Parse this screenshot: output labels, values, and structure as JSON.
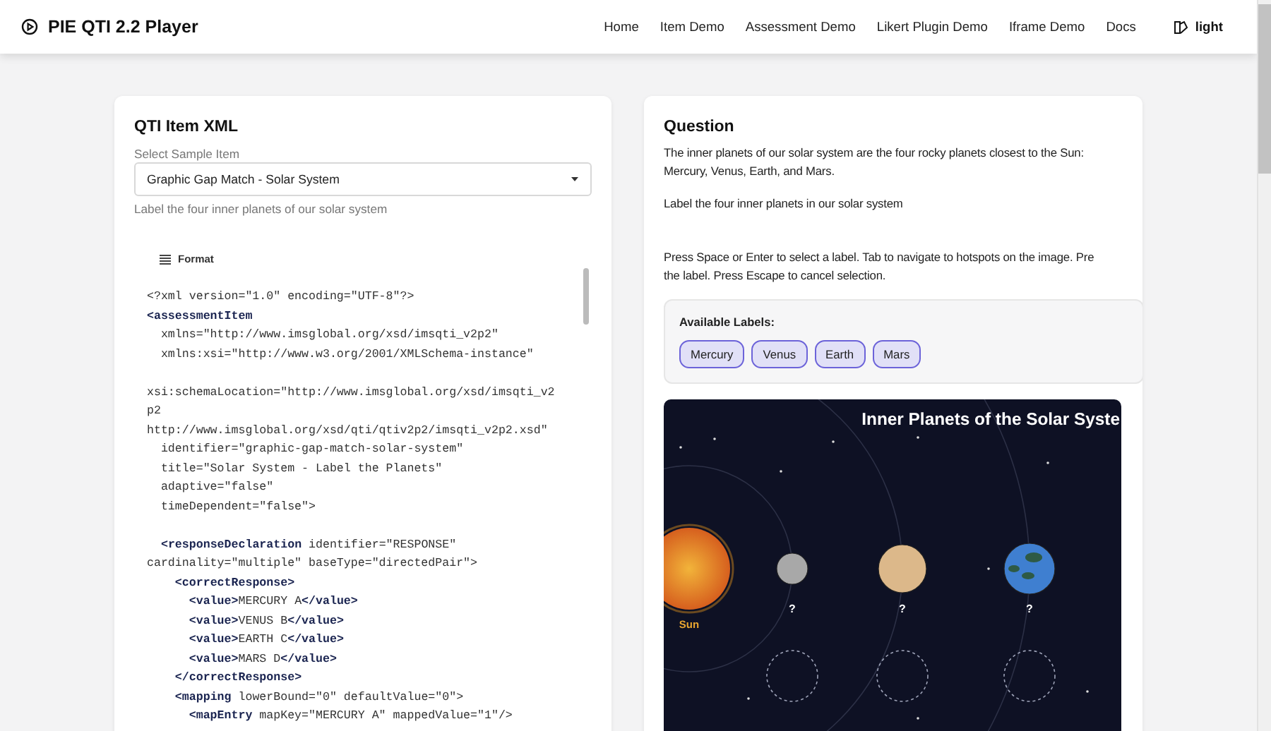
{
  "header": {
    "title": "PIE QTI 2.2 Player",
    "nav": [
      "Home",
      "Item Demo",
      "Assessment Demo",
      "Likert Plugin Demo",
      "Iframe Demo",
      "Docs"
    ],
    "theme_toggle": "light"
  },
  "xml_panel": {
    "title": "QTI Item XML",
    "select_label": "Select Sample Item",
    "select_value": "Graphic Gap Match - Solar System",
    "help": "Label the four inner planets of our solar system",
    "format_button": "Format",
    "code_blocks": [
      [
        "<?xml version=\"1.0\" encoding=\"UTF-8\"?>",
        "**<assessmentItem**",
        "  xmlns=\"http://www.imsglobal.org/xsd/imsqti_v2p2\"",
        "  xmlns:xsi=\"http://www.w3.org/2001/XMLSchema-instance\""
      ],
      [
        "xsi:schemaLocation=\"http://www.imsglobal.org/xsd/imsqti_v2",
        "p2",
        "http://www.imsglobal.org/xsd/qti/qtiv2p2/imsqti_v2p2.xsd\"",
        "  identifier=\"graphic-gap-match-solar-system\"",
        "  title=\"Solar System - Label the Planets\"",
        "  adaptive=\"false\"",
        "  timeDependent=\"false\">"
      ],
      [
        "  **<responseDeclaration** identifier=\"RESPONSE\"",
        "cardinality=\"multiple\" baseType=\"directedPair\">",
        "    **<correctResponse>**",
        "      **<value>**MERCURY A**</value>**",
        "      **<value>**VENUS B**</value>**",
        "      **<value>**EARTH C**</value>**",
        "      **<value>**MARS D**</value>**",
        "    **</correctResponse>**",
        "    **<mapping** lowerBound=\"0\" defaultValue=\"0\">",
        "      **<mapEntry** mapKey=\"MERCURY A\" mappedValue=\"1\"/>"
      ]
    ]
  },
  "question": {
    "title": "Question",
    "paragraphs": [
      "The inner planets of our solar system are the four rocky planets closest to the Sun: Mercury, Venus, Earth, and Mars.",
      "Label the four inner planets in our solar system"
    ],
    "instructions": [
      "Press Space or Enter to select a label. Tab to navigate to hotspots on the image. Pre",
      "the label. Press Escape to cancel selection."
    ],
    "labels_title": "Available Labels:",
    "labels": [
      "Mercury",
      "Venus",
      "Earth",
      "Mars"
    ],
    "image": {
      "title": "Inner Planets of the Solar Syste",
      "sun_label": "Sun",
      "planets": [
        {
          "color": "#a8a8a8",
          "label": "?"
        },
        {
          "color": "#dcb88a",
          "label": "?"
        },
        {
          "color": "#3f7fd0",
          "label": "?"
        }
      ]
    }
  }
}
